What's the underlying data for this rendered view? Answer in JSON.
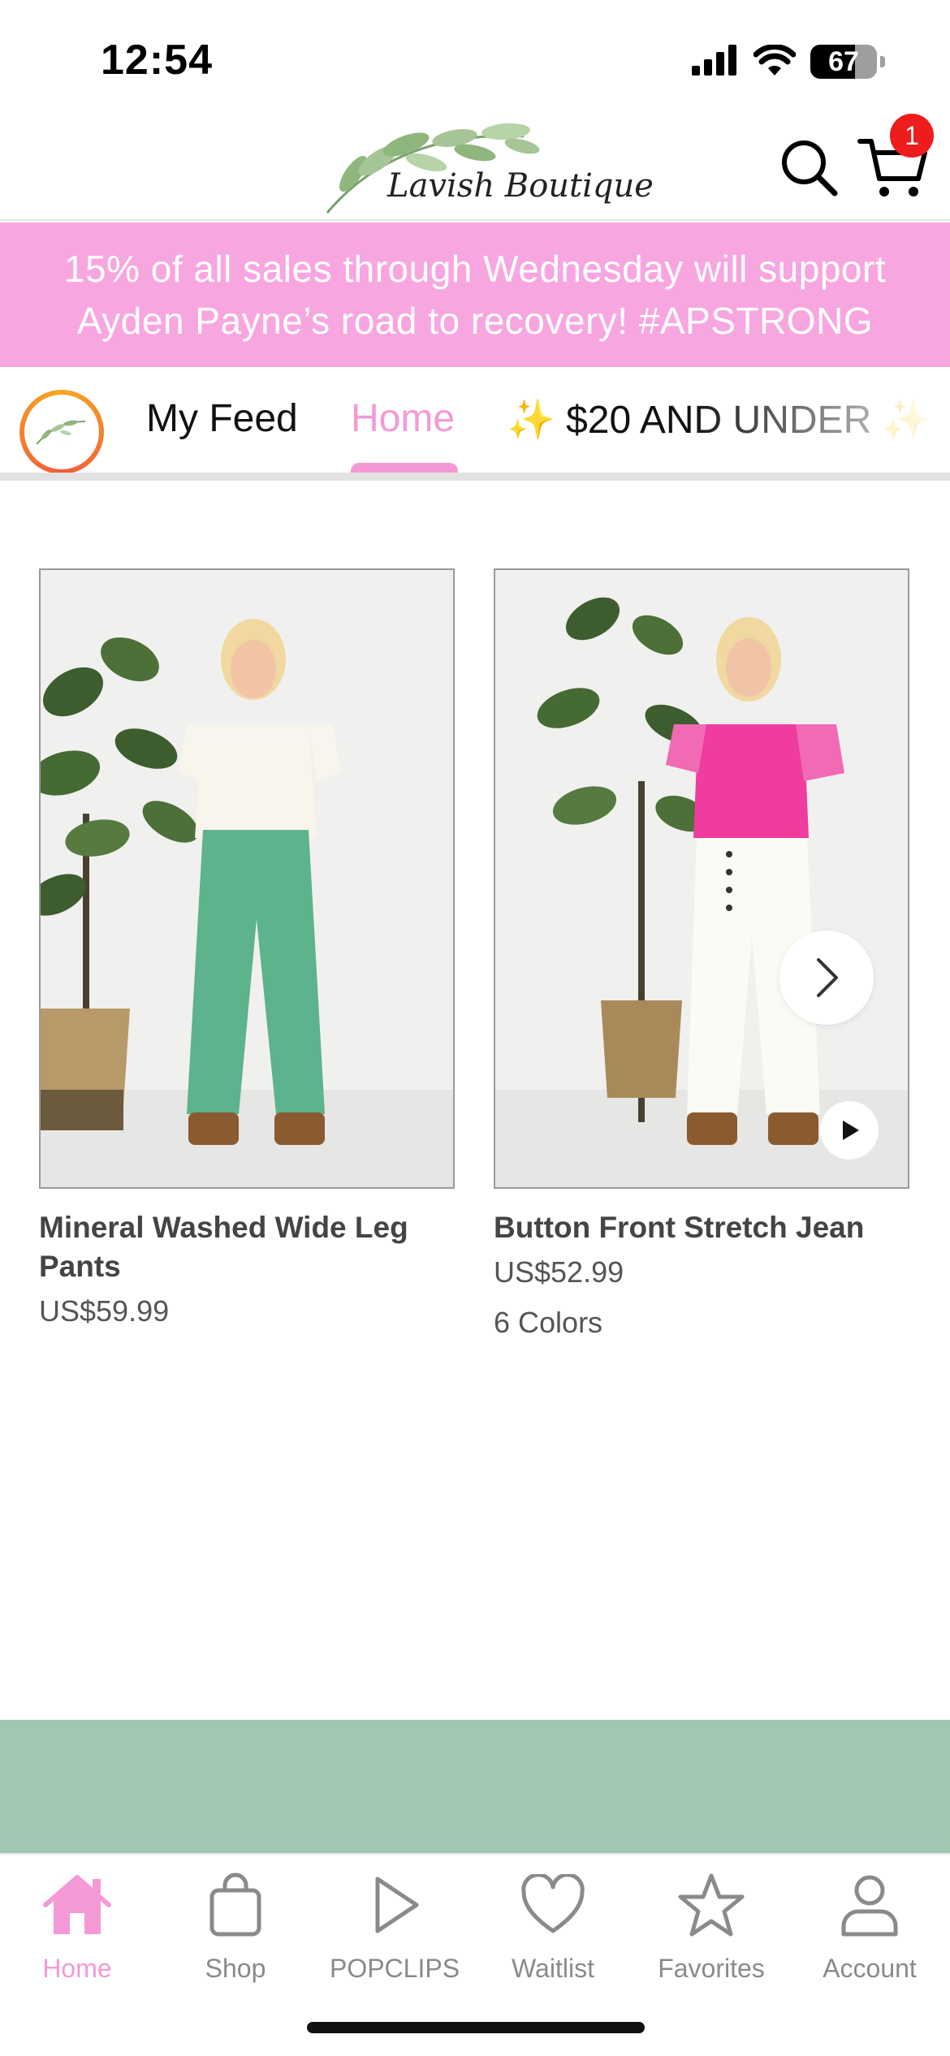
{
  "status_bar": {
    "time": "12:54",
    "battery_percent": "67",
    "battery_level": 0.67,
    "icons": [
      "signal-icon",
      "wifi-icon",
      "battery-icon"
    ]
  },
  "header": {
    "logo_text": "Lavish Boutique",
    "cart_count": "1",
    "icons": [
      "search-icon",
      "cart-icon"
    ]
  },
  "promo": {
    "line1": "15% of all sales through Wednesday will support",
    "line2": "Ayden Payne’s road to recovery! #APSTRONG"
  },
  "tabs": {
    "items": [
      {
        "label": "My Feed",
        "active": false
      },
      {
        "label": "Home",
        "active": true
      },
      {
        "label": "✨ $20 AND UNDER ✨",
        "active": false
      }
    ]
  },
  "products": [
    {
      "title": "Mineral Washed Wide Leg Pants",
      "price": "US$59.99",
      "colors": ""
    },
    {
      "title": "Button Front Stretch Jean",
      "price": "US$52.99",
      "colors": "6 Colors"
    }
  ],
  "bottom_nav": {
    "items": [
      {
        "label": "Home",
        "icon": "home-icon",
        "active": true
      },
      {
        "label": "Shop",
        "icon": "shopping-bag-icon",
        "active": false
      },
      {
        "label": "POPCLIPS",
        "icon": "play-icon",
        "active": false
      },
      {
        "label": "Waitlist",
        "icon": "heart-icon",
        "active": false
      },
      {
        "label": "Favorites",
        "icon": "star-icon",
        "active": false
      },
      {
        "label": "Account",
        "icon": "person-icon",
        "active": false
      }
    ]
  },
  "colors": {
    "accent_pink": "#f39ad6",
    "banner_pink": "#f7a6e0",
    "badge_red": "#ee1c1c",
    "band_green": "#a3c6b3"
  }
}
